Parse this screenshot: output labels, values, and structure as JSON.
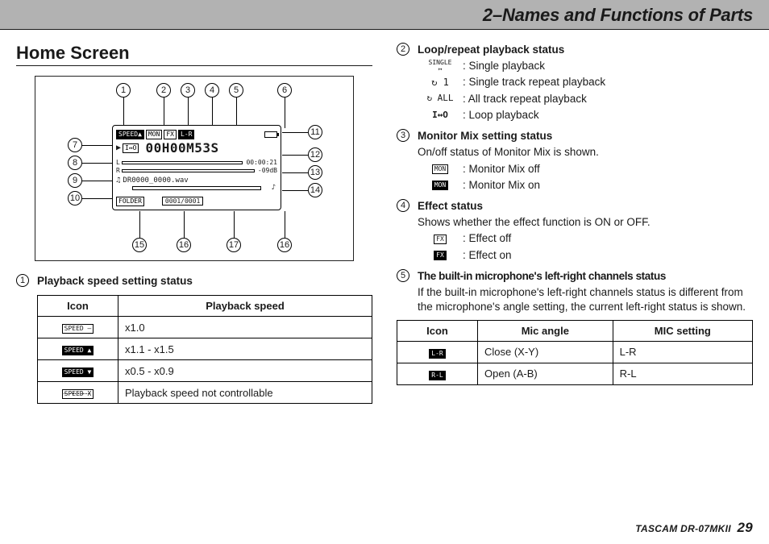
{
  "header": "2–Names and Functions of Parts",
  "section_title": "Home Screen",
  "footer": {
    "model": "TASCAM DR-07MKII",
    "page": "29"
  },
  "diagram": {
    "top": [
      "1",
      "2",
      "3",
      "4",
      "5",
      "6"
    ],
    "left": [
      "7",
      "8",
      "9",
      "10"
    ],
    "right": [
      "11",
      "12",
      "13",
      "14"
    ],
    "bottom": [
      "15",
      "16",
      "17",
      "16"
    ],
    "lcd": {
      "row1_chips": [
        "SPEED▲",
        "MON",
        "FX",
        "L-R"
      ],
      "time_main": "00H00M53S",
      "loop_icon": "I↔O",
      "time_small": "00:00:21",
      "db": "-09dB",
      "filename": "DR0000_0000.wav",
      "folder": "FOLDER",
      "counter": "0001/0001"
    }
  },
  "item1": {
    "title": "Playback speed setting status",
    "table": {
      "headers": [
        "Icon",
        "Playback speed"
      ],
      "rows": [
        {
          "icon": "SPEED –",
          "filled": false,
          "text": "x1.0"
        },
        {
          "icon": "SPEED ▲",
          "filled": true,
          "text": "x1.1 - x1.5"
        },
        {
          "icon": "SPEED ▼",
          "filled": true,
          "text": "x0.5 - x0.9"
        },
        {
          "icon": "SPEED X",
          "filled": false,
          "text": "Playback speed not controllable"
        }
      ]
    }
  },
  "item2": {
    "title": "Loop/repeat playback status",
    "subs": [
      {
        "icon": "SINGLE",
        "text": ": Single playback"
      },
      {
        "icon": "↻ 1",
        "text": ": Single track repeat playback"
      },
      {
        "icon": "↻ ALL",
        "text": ": All track repeat playback"
      },
      {
        "icon": "I↔O",
        "text": ": Loop playback"
      }
    ]
  },
  "item3": {
    "title": "Monitor Mix setting status",
    "desc": "On/off status of Monitor Mix is shown.",
    "subs": [
      {
        "icon": "MON",
        "filled": false,
        "text": ": Monitor Mix off"
      },
      {
        "icon": "MON",
        "filled": true,
        "text": ": Monitor Mix on"
      }
    ]
  },
  "item4": {
    "title": "Effect status",
    "desc": "Shows whether the effect function is ON or OFF.",
    "subs": [
      {
        "icon": "FX",
        "filled": false,
        "text": ": Effect off"
      },
      {
        "icon": "FX",
        "filled": true,
        "text": ": Effect on"
      }
    ]
  },
  "item5": {
    "title": "The built-in microphone's left-right channels status",
    "desc": "If the built-in microphone's left-right channels status is different from the microphone's angle setting, the current left-right status is shown.",
    "table": {
      "headers": [
        "Icon",
        "Mic angle",
        "MIC setting"
      ],
      "rows": [
        {
          "icon": "L-R",
          "angle": "Close (X-Y)",
          "setting": "L-R"
        },
        {
          "icon": "R-L",
          "angle": "Open (A-B)",
          "setting": "R-L"
        }
      ]
    }
  }
}
